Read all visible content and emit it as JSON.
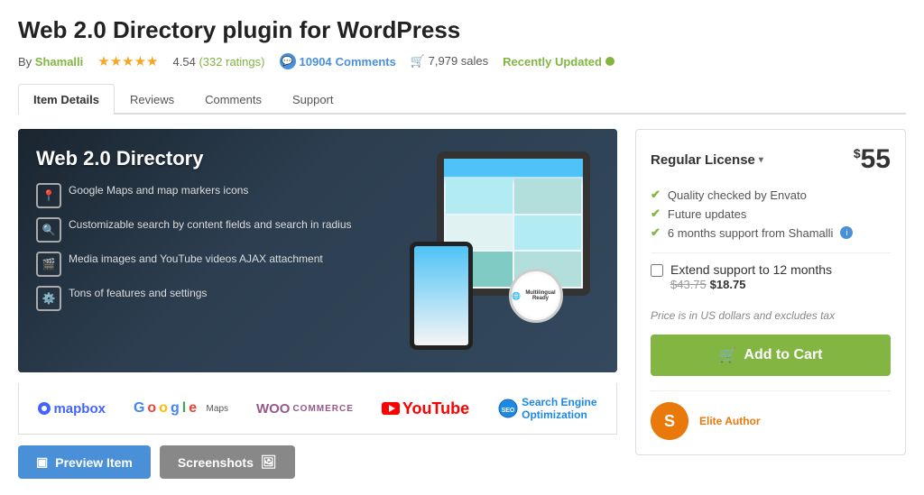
{
  "page": {
    "title": "Web 2.0 Directory plugin for WordPress",
    "author": {
      "prefix": "By",
      "name": "Shamalli",
      "link": "#"
    },
    "rating": {
      "stars": "★★★★★",
      "value": "4.54",
      "count": "332",
      "label": "ratings"
    },
    "comments": {
      "count": "10904",
      "label": "Comments"
    },
    "sales": "7,979 sales",
    "recently_updated": "Recently Updated"
  },
  "tabs": [
    {
      "label": "Item Details",
      "active": true
    },
    {
      "label": "Reviews",
      "active": false
    },
    {
      "label": "Comments",
      "active": false
    },
    {
      "label": "Support",
      "active": false
    }
  ],
  "plugin": {
    "banner_title": "Web 2.0 Directory",
    "features": [
      {
        "icon": "📍",
        "text": "Google Maps and map markers icons"
      },
      {
        "icon": "🔍",
        "text": "Customizable search by content fields and search in radius"
      },
      {
        "icon": "🎬",
        "text": "Media images and YouTube videos AJAX attachment"
      },
      {
        "icon": "⚙️",
        "text": "Tons of features and settings"
      }
    ],
    "seal_text": "Multilingual Ready",
    "partner_logos": [
      {
        "name": "mapbox",
        "label": "mapbox"
      },
      {
        "name": "google-maps",
        "label": "Google Maps"
      },
      {
        "name": "woocommerce",
        "label": "WOO COMMERCE"
      },
      {
        "name": "youtube",
        "label": "YouTube"
      },
      {
        "name": "seo",
        "label": "SEO"
      }
    ]
  },
  "actions": {
    "preview_label": "Preview Item",
    "screenshots_label": "Screenshots"
  },
  "purchase": {
    "license_label": "Regular License",
    "price_symbol": "$",
    "price": "55",
    "checklist": [
      {
        "text": "Quality checked by Envato"
      },
      {
        "text": "Future updates"
      },
      {
        "text": "6 months support from Shamalli",
        "has_info": true
      }
    ],
    "extend_support_label": "Extend support to 12 months",
    "extend_price_old": "$43.75",
    "extend_price_new": "$18.75",
    "tax_note": "Price is in US dollars and excludes tax",
    "add_to_cart_label": "Add to Cart",
    "author": {
      "name": "Elite Author",
      "badge": "Elite Author",
      "initials": "S"
    }
  }
}
